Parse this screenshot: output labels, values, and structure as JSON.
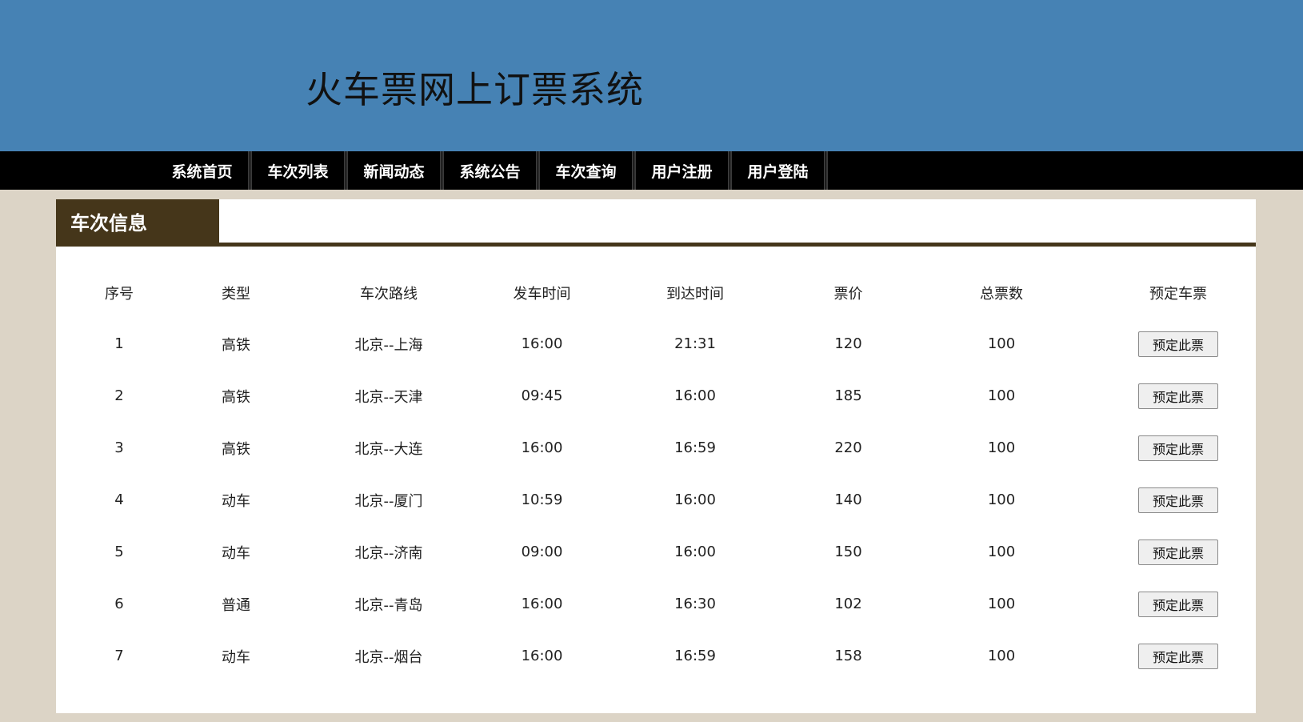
{
  "header": {
    "title": "火车票网上订票系统"
  },
  "nav": {
    "items": [
      "系统首页",
      "车次列表",
      "新闻动态",
      "系统公告",
      "车次查询",
      "用户注册",
      "用户登陆"
    ]
  },
  "panel": {
    "title": "车次信息"
  },
  "table": {
    "headers": [
      "序号",
      "类型",
      "车次路线",
      "发车时间",
      "到达时间",
      "票价",
      "总票数",
      "预定车票"
    ],
    "rows": [
      {
        "no": "1",
        "type": "高铁",
        "route": "北京--上海",
        "depart": "16:00",
        "arrive": "21:31",
        "price": "120",
        "total": "100",
        "action": "预定此票"
      },
      {
        "no": "2",
        "type": "高铁",
        "route": "北京--天津",
        "depart": "09:45",
        "arrive": "16:00",
        "price": "185",
        "total": "100",
        "action": "预定此票"
      },
      {
        "no": "3",
        "type": "高铁",
        "route": "北京--大连",
        "depart": "16:00",
        "arrive": "16:59",
        "price": "220",
        "total": "100",
        "action": "预定此票"
      },
      {
        "no": "4",
        "type": "动车",
        "route": "北京--厦门",
        "depart": "10:59",
        "arrive": "16:00",
        "price": "140",
        "total": "100",
        "action": "预定此票"
      },
      {
        "no": "5",
        "type": "动车",
        "route": "北京--济南",
        "depart": "09:00",
        "arrive": "16:00",
        "price": "150",
        "total": "100",
        "action": "预定此票"
      },
      {
        "no": "6",
        "type": "普通",
        "route": "北京--青岛",
        "depart": "16:00",
        "arrive": "16:30",
        "price": "102",
        "total": "100",
        "action": "预定此票"
      },
      {
        "no": "7",
        "type": "动车",
        "route": "北京--烟台",
        "depart": "16:00",
        "arrive": "16:59",
        "price": "158",
        "total": "100",
        "action": "预定此票"
      }
    ]
  },
  "colors": {
    "header_bg": "#4682b4",
    "nav_bg": "#000000",
    "accent": "#45361a",
    "page_bg": "#dcd4c6"
  }
}
